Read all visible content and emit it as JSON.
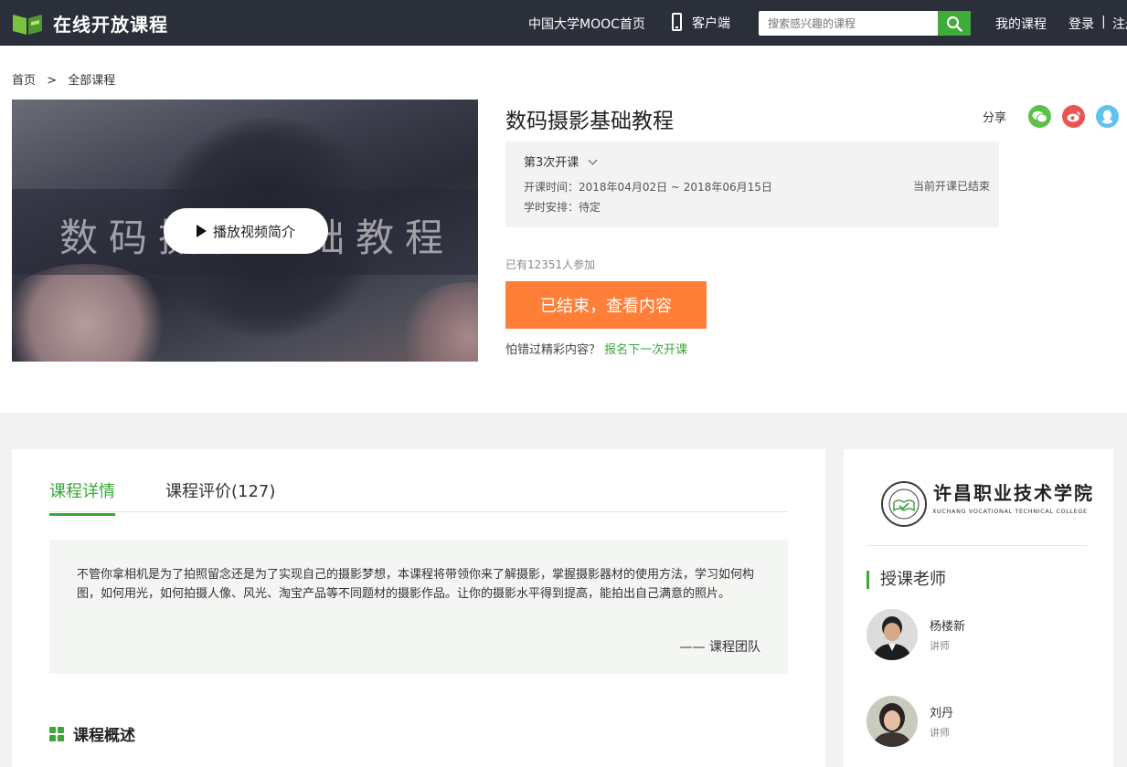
{
  "nav": {
    "logo_text": "在线开放课程",
    "mooc_home": "中国大学MOOC首页",
    "client": "客户端",
    "search_placeholder": "搜索感兴趣的课程",
    "my_courses": "我的课程",
    "login": "登录",
    "separator": "|",
    "register": "注册"
  },
  "breadcrumb": {
    "home": "首页",
    "sep": ">",
    "current": "全部课程"
  },
  "video": {
    "overlay_title": "数码摄影基础教程",
    "play_label": "播放视频简介"
  },
  "course": {
    "title": "数码摄影基础教程",
    "share_label": "分享",
    "term": "第3次开课",
    "time_label": "开课时间：",
    "time_value": "2018年04月02日 ~ 2018年06月15日",
    "schedule_label": "学时安排：",
    "schedule_value": "待定",
    "status": "当前开课已结束",
    "enrolled": "已有12351人参加",
    "cta": "已结束，查看内容",
    "miss_text": "怕错过精彩内容？",
    "miss_link": "报名下一次开课"
  },
  "tabs": [
    {
      "label": "课程详情"
    },
    {
      "label": "课程评价(127)"
    }
  ],
  "intro": {
    "text": "不管你拿相机是为了拍照留念还是为了实现自己的摄影梦想，本课程将带领你来了解摄影，掌握摄影器材的使用方法，学习如何构图，如何用光，如何拍摄人像、风光、淘宝产品等不同题材的摄影作品。让你的摄影水平得到提高，能拍出自己满意的照片。",
    "signature": "—— 课程团队"
  },
  "section_title": "课程概述",
  "school": {
    "name_cn": "许昌职业技术学院",
    "name_en": "XUCHANG VOCATIONAL TECHNICAL COLLEGE"
  },
  "teachers": {
    "heading": "授课老师",
    "list": [
      {
        "name": "杨楼新",
        "role": "讲师"
      },
      {
        "name": "刘丹",
        "role": "讲师"
      }
    ]
  },
  "colors": {
    "brand_green": "#39a837",
    "cta_orange": "#ff7f38",
    "topbar": "#2b2f3a"
  }
}
